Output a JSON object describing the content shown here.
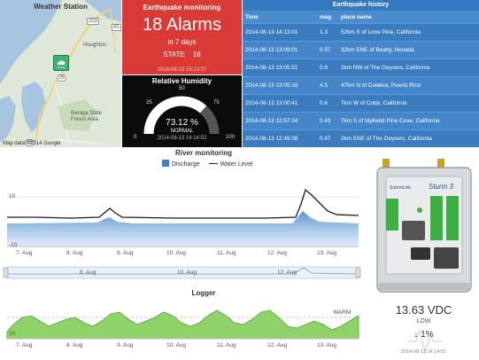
{
  "map": {
    "title": "Weather Station",
    "labels": {
      "houghton": "Houghton",
      "forest": "Baraga State\nForest Area",
      "r41": "41",
      "r203": "203",
      "r26": "26",
      "r38": "38"
    },
    "footer": "Map data ©2014 Google",
    "marker_icon": "weather-station-icon"
  },
  "earthquake_monitoring": {
    "title": "Earthquake monitoring",
    "count_text": "18 Alarms",
    "period": "in 7 days",
    "state_label": "STATE",
    "state_value": "18",
    "timestamp": "2014-08-13 15:13:27",
    "color": "#d93a35"
  },
  "humidity": {
    "title": "Relative Humidity",
    "value_text": "73.12 %",
    "status": "NORMAL",
    "timestamp": "2014-08-13 14:14:52",
    "value": 73.12,
    "scale": {
      "min_label": "0",
      "max_label": "100",
      "label_25": "25",
      "label_50": "50",
      "label_75": "75"
    }
  },
  "earthquake_history": {
    "title": "Earthquake history",
    "columns": [
      "Time",
      "mag",
      "place name"
    ],
    "rows": [
      [
        "2014-08-13 14:13:01",
        "1.3",
        "52km S of Lone Pine, California"
      ],
      [
        "2014-08-13 13:09:01",
        "0.97",
        "32km ENE of Beatty, Nevada"
      ],
      [
        "2014-08-13 13:05:51",
        "0.9",
        "2km NW of The Geysers, California"
      ],
      [
        "2014-08-13 13:05:16",
        "4.5",
        "47km N of Culebra, Puerto Rico"
      ],
      [
        "2014-08-13 13:00:41",
        "0.6",
        "7km W of Cobb, California"
      ],
      [
        "2014-08-13 12:57:34",
        "0.43",
        "7km S of Idyllwild-Pine Cove, California"
      ],
      [
        "2014-08-13 12:49:38",
        "0.47",
        "2km ENE of The Geysers, California"
      ]
    ]
  },
  "river": {
    "title": "River monitoring",
    "legend": {
      "discharge": "Discharge",
      "water_level": "Water Level"
    },
    "y_ticks": [
      "10",
      "-10"
    ],
    "x_ticks": [
      "7. Aug",
      "8. Aug",
      "9. Aug",
      "10. Aug",
      "11. Aug",
      "12. Aug",
      "13. Aug"
    ],
    "navigator_ticks": [
      "8. Aug",
      "10. Aug",
      "12. Aug"
    ],
    "discharge_color": "#3b82c8"
  },
  "logger": {
    "title": "Logger",
    "warm_label": "WARM",
    "y_tick": "20",
    "x_ticks": [
      "7. Aug",
      "8. Aug",
      "9. Aug",
      "10. Aug",
      "11. Aug",
      "12. Aug",
      "13. Aug"
    ],
    "fill_color": "#78c850"
  },
  "device": {
    "name": "Sturm 3",
    "brand": "SutronLink",
    "voltage": "13.63 VDC",
    "level": "LOW",
    "trend": "↓ 1%",
    "timestamp": "2014-08-13 14:14:52"
  }
}
